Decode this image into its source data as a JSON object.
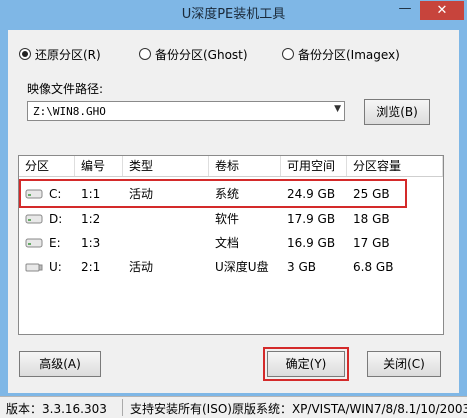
{
  "window": {
    "title": "U深度PE装机工具",
    "minimize": "—",
    "close": "✕"
  },
  "options": [
    {
      "label": "还原分区(R)",
      "selected": true
    },
    {
      "label": "备份分区(Ghost)",
      "selected": false
    },
    {
      "label": "备份分区(Imagex)",
      "selected": false
    }
  ],
  "image_path": {
    "label": "映像文件路径:",
    "value": "Z:\\WIN8.GHO",
    "browse": "浏览(B)"
  },
  "table": {
    "columns": [
      "分区",
      "编号",
      "类型",
      "卷标",
      "可用空间",
      "分区容量"
    ],
    "rows": [
      {
        "drive": "C:",
        "num": "1:1",
        "type": "活动",
        "label": "系统",
        "free": "24.9 GB",
        "size": "25 GB",
        "icon": "hard-drive-icon"
      },
      {
        "drive": "D:",
        "num": "1:2",
        "type": "",
        "label": "软件",
        "free": "17.9 GB",
        "size": "18 GB",
        "icon": "hard-drive-icon"
      },
      {
        "drive": "E:",
        "num": "1:3",
        "type": "",
        "label": "文档",
        "free": "16.9 GB",
        "size": "17 GB",
        "icon": "hard-drive-icon"
      },
      {
        "drive": "U:",
        "num": "2:1",
        "type": "活动",
        "label": "U深度U盘",
        "free": "3 GB",
        "size": "6.8 GB",
        "icon": "usb-drive-icon"
      }
    ]
  },
  "buttons": {
    "advanced": "高级(A)",
    "ok": "确定(Y)",
    "close": "关闭(C)"
  },
  "status": {
    "version": "版本：3.3.16.303",
    "support": "支持安装所有(ISO)原版系统：XP/VISTA/WIN7/8/8.1/10/2003"
  }
}
